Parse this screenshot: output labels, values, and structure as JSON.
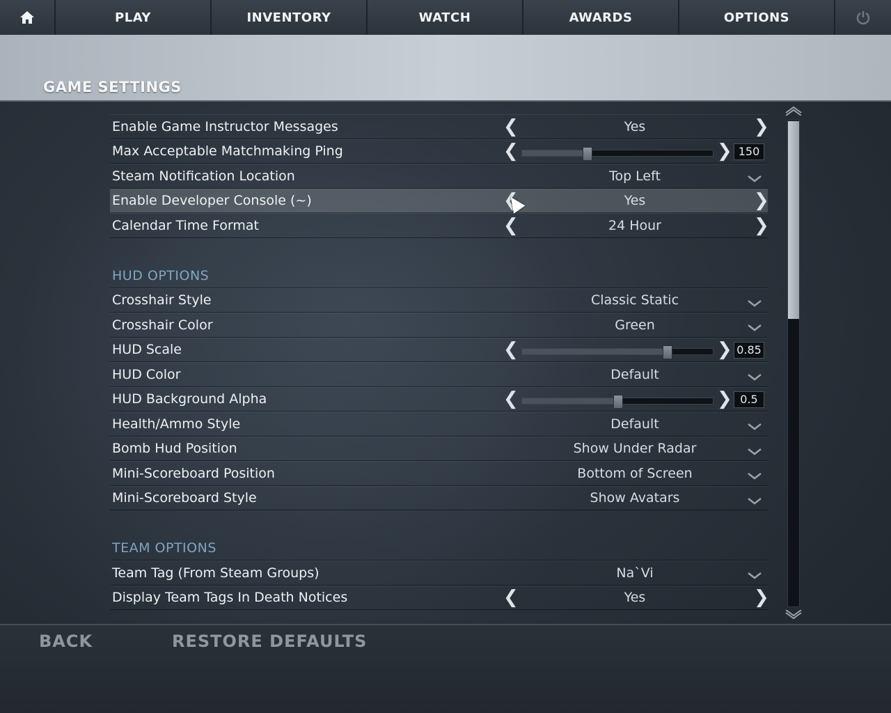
{
  "nav": {
    "home_icon": "home-icon",
    "tabs": [
      "PLAY",
      "INVENTORY",
      "WATCH",
      "AWARDS",
      "OPTIONS"
    ],
    "power_icon": "power-icon"
  },
  "header": {
    "title": "GAME SETTINGS"
  },
  "game_settings": [
    {
      "label": "Enable Game Instructor Messages",
      "type": "toggle",
      "value": "Yes"
    },
    {
      "label": "Max Acceptable Matchmaking Ping",
      "type": "slider",
      "value": "150",
      "level": 0.34
    },
    {
      "label": "Steam Notification Location",
      "type": "dropdown",
      "value": "Top Left"
    },
    {
      "label": "Enable Developer Console (~)",
      "type": "toggle",
      "value": "Yes",
      "highlighted": true
    },
    {
      "label": "Calendar Time Format",
      "type": "toggle",
      "value": "24 Hour"
    }
  ],
  "hud": {
    "title": "HUD OPTIONS",
    "items": [
      {
        "label": "Crosshair Style",
        "type": "dropdown",
        "value": "Classic Static"
      },
      {
        "label": "Crosshair Color",
        "type": "dropdown",
        "value": "Green"
      },
      {
        "label": "HUD Scale",
        "type": "slider",
        "value": "0.85",
        "level": 0.76
      },
      {
        "label": "HUD Color",
        "type": "dropdown",
        "value": "Default"
      },
      {
        "label": "HUD Background Alpha",
        "type": "slider",
        "value": "0.5",
        "level": 0.5
      },
      {
        "label": "Health/Ammo Style",
        "type": "dropdown",
        "value": "Default"
      },
      {
        "label": "Bomb Hud Position",
        "type": "dropdown",
        "value": "Show Under Radar"
      },
      {
        "label": "Mini-Scoreboard Position",
        "type": "dropdown",
        "value": "Bottom of Screen"
      },
      {
        "label": "Mini-Scoreboard Style",
        "type": "dropdown",
        "value": "Show Avatars"
      }
    ]
  },
  "team": {
    "title": "TEAM OPTIONS",
    "items": [
      {
        "label": "Team Tag (From Steam Groups)",
        "type": "dropdown",
        "value": "Na`Vi"
      },
      {
        "label": "Display Team Tags In Death Notices",
        "type": "toggle",
        "value": "Yes"
      }
    ]
  },
  "footer": {
    "back": "BACK",
    "restore": "RESTORE DEFAULTS"
  },
  "icons": {
    "left_arrow": "chevron-left-icon",
    "right_arrow": "chevron-right-icon",
    "dropdown": "chevron-down-icon"
  },
  "colors": {
    "section_title": "#7fa5c3",
    "header_band": "#c7cfd6"
  }
}
